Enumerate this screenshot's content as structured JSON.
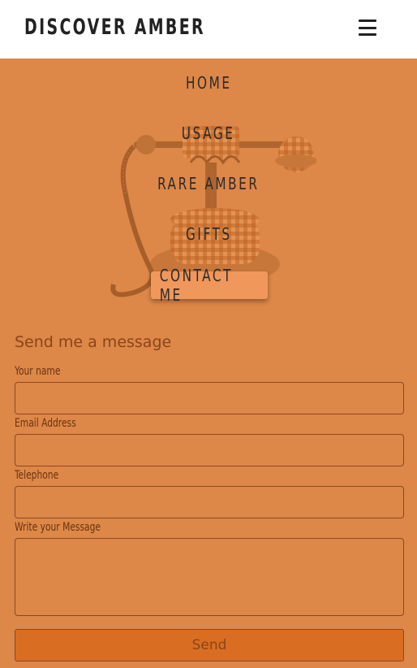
{
  "header": {
    "brand": "DISCOVER AMBER",
    "menu_icon": "hamburger-menu-icon"
  },
  "nav": {
    "items": [
      {
        "label": "HOME"
      },
      {
        "label": "USAGE"
      },
      {
        "label": "RARE AMBER"
      },
      {
        "label": "GIFTS"
      },
      {
        "label": "CONTACT ME",
        "active": true
      }
    ]
  },
  "hero": {
    "image": "antique-amber-telephone-image"
  },
  "form": {
    "title": "Send me a message",
    "name_label": "Your name",
    "name_value": "",
    "email_label": "Email Address",
    "email_value": "",
    "phone_label": "Telephone",
    "phone_value": "",
    "message_label": "Write your Message",
    "message_value": "",
    "send_label": "Send"
  },
  "colors": {
    "background": "#dd8748",
    "header_bg": "#ffffff",
    "active_nav": "#f0975b",
    "button": "#d96d22",
    "text_dark": "#2b2b2b",
    "text_brown": "#8a4519"
  }
}
